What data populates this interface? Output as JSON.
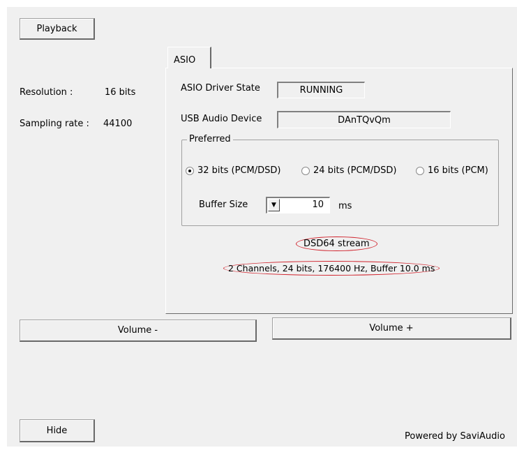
{
  "buttons": {
    "playback": "Playback",
    "volume_down": "Volume -",
    "volume_up": "Volume +",
    "hide": "Hide"
  },
  "info": {
    "resolution_label": "Resolution :",
    "resolution_value": "16 bits",
    "sampling_label": "Sampling rate :",
    "sampling_value": "44100"
  },
  "tab": {
    "label": "ASIO"
  },
  "asio": {
    "driver_state_label": "ASIO Driver State",
    "driver_state_value": "RUNNING",
    "usb_device_label": "USB Audio Device",
    "usb_device_value": "DAnTQvQm"
  },
  "preferred": {
    "group_label": "Preferred",
    "options": [
      {
        "label": "32 bits (PCM/DSD)",
        "selected": true
      },
      {
        "label": "24 bits (PCM/DSD)",
        "selected": false
      },
      {
        "label": "16 bits (PCM)",
        "selected": false
      }
    ],
    "buffer_label": "Buffer Size",
    "buffer_value": "10",
    "buffer_unit": "ms"
  },
  "stream": {
    "type": "DSD64 stream",
    "details": "2 Channels, 24 bits, 176400 Hz, Buffer 10.0 ms"
  },
  "footer": {
    "powered_by": "Powered by SaviAudio"
  },
  "colors": {
    "panel": "#f0f0f0",
    "highlight_ellipse": "#d0202a"
  }
}
